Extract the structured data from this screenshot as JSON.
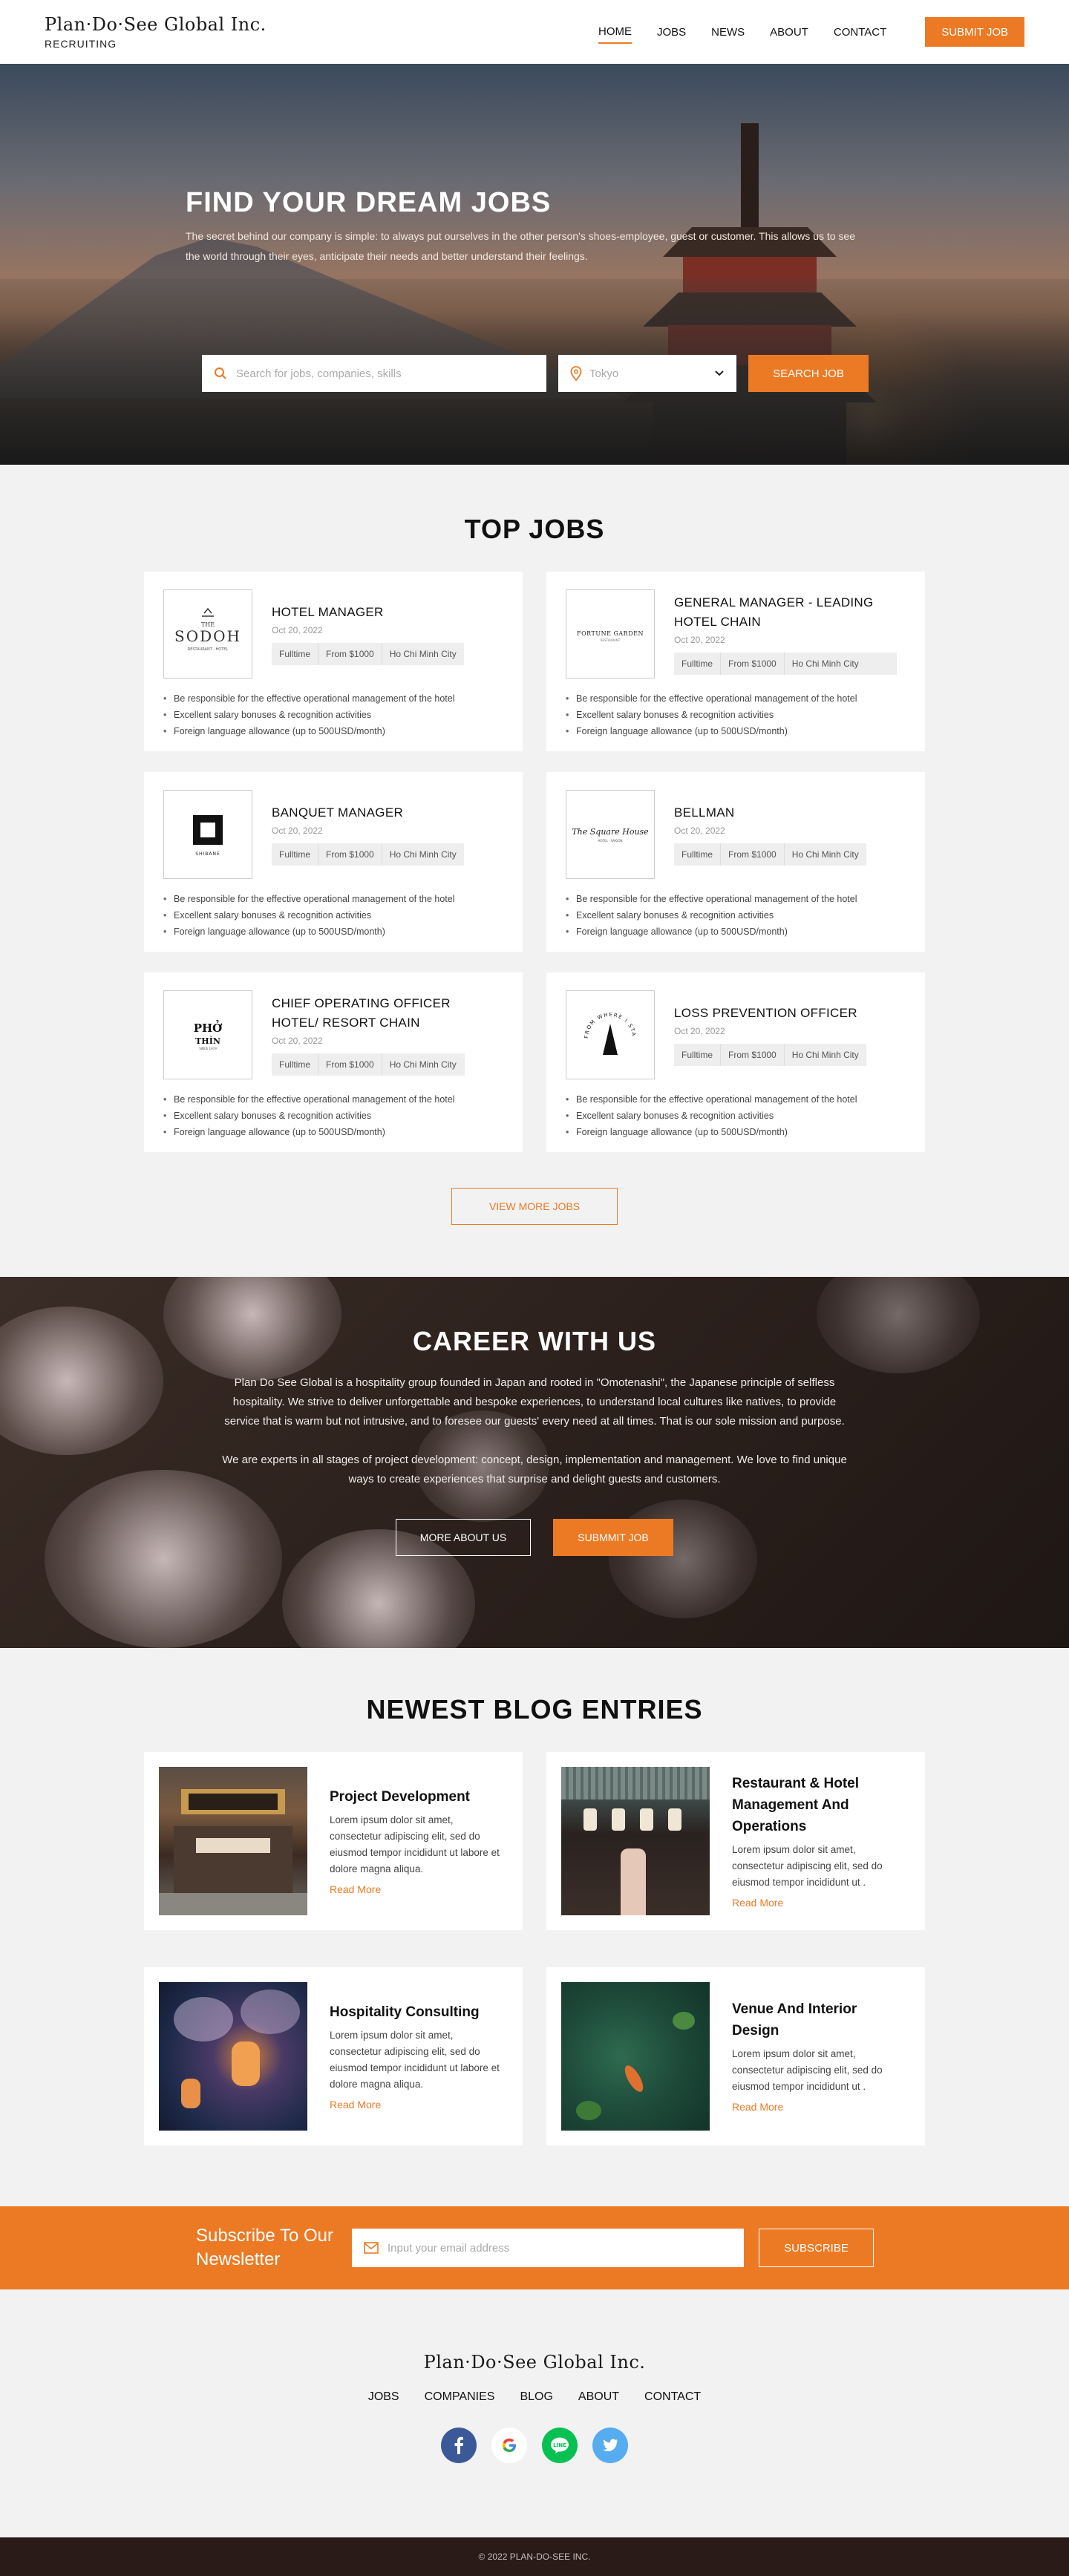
{
  "header": {
    "brand": "Plan·Do·See Global Inc.",
    "brand_sub": "RECRUITING",
    "nav": [
      "HOME",
      "JOBS",
      "NEWS",
      "ABOUT",
      "CONTACT"
    ],
    "active_nav": "HOME",
    "submit_label": "SUBMIT JOB"
  },
  "hero": {
    "title": "FIND YOUR DREAM JOBS",
    "description": "The secret behind our company is simple: to always put ourselves in the other person's shoes-employee, guest or customer. This allows us to see the world through their eyes,  anticipate their needs and better understand their feelings.",
    "search_placeholder": "Search for jobs, companies, skills",
    "location": "Tokyo",
    "search_label": "SEARCH JOB"
  },
  "top_jobs": {
    "title": "TOP JOBS",
    "jobs": [
      {
        "title": "HOTEL MANAGER",
        "date": "Oct 20, 2022",
        "logo": "THE SODOH"
      },
      {
        "title": "GENERAL MANAGER - LEADING HOTEL CHAIN",
        "date": "Oct 20, 2022",
        "logo": "FORTUNE GARDEN"
      },
      {
        "title": "BANQUET MANAGER",
        "date": "Oct 20, 2022",
        "logo": "SHIBANE"
      },
      {
        "title": "BELLMAN",
        "date": "Oct 20, 2022",
        "logo": "The Square House"
      },
      {
        "title": "CHIEF OPERATING OFFICER HOTEL/ RESORT CHAIN",
        "date": "Oct 20, 2022",
        "logo": "PHỞ THÌN"
      },
      {
        "title": "LOSS PREVENTION OFFICER",
        "date": "Oct 20, 2022",
        "logo": "FROM WHERE I STAND"
      }
    ],
    "tags": [
      "Fulltime",
      "From $1000",
      "Ho Chi Minh City"
    ],
    "bullets": [
      "Be responsible for the effective operational management of the hotel",
      "Excellent salary bonuses & recognition activities",
      "Foreign language allowance (up to 500USD/month)"
    ],
    "view_more": "VIEW MORE JOBS"
  },
  "career": {
    "title": "CAREER WITH US",
    "para1": "Plan Do See Global is a hospitality group founded in Japan and rooted in \"Omotenashi\", the Japanese principle of selfless hospitality. We strive to deliver unforgettable and bespoke experiences, to understand local cultures like natives, to provide service that is warm but not intrusive, and to foresee our guests' every need at all times. That is our sole mission and purpose.",
    "para2": "We are experts in all stages of project development: concept, design, implementation and management. We love to find unique ways to create experiences that surprise and delight guests and customers.",
    "more_label": "MORE ABOUT US",
    "submit_label": "SUBMMIT JOB"
  },
  "blog": {
    "title": "NEWEST BLOG ENTRIES",
    "entries": [
      {
        "title": "Project Development",
        "text": "Lorem ipsum dolor sit amet, consectetur adipiscing elit, sed do eiusmod tempor incididunt ut labore et dolore magna aliqua."
      },
      {
        "title": "Restaurant & Hotel Management And Operations",
        "text": "Lorem ipsum dolor sit amet, consectetur adipiscing elit, sed do eiusmod tempor incididunt ut ."
      },
      {
        "title": "Hospitality Consulting",
        "text": "Lorem ipsum dolor sit amet, consectetur adipiscing elit, sed do eiusmod tempor incididunt ut labore et dolore magna aliqua."
      },
      {
        "title": "Venue And Interior Design",
        "text": "Lorem ipsum dolor sit amet, consectetur adipiscing elit, sed do eiusmod tempor incididunt ut ."
      }
    ],
    "read_more": "Read More"
  },
  "newsletter": {
    "title": "Subscribe To Our Newsletter",
    "placeholder": "Input your email address",
    "button": "SUBSCRIBE"
  },
  "footer": {
    "brand": "Plan·Do·See Global Inc.",
    "nav": [
      "JOBS",
      "COMPANIES",
      "BLOG",
      "ABOUT",
      "CONTACT"
    ],
    "socials": [
      "facebook-icon",
      "google-icon",
      "line-icon",
      "twitter-icon"
    ],
    "copyright": "© 2022 PLAN-DO-SEE INC."
  },
  "colors": {
    "accent": "#ec7a24",
    "footer_bar": "#2a1a18",
    "facebook": "#3b5998",
    "line": "#06c152",
    "twitter": "#55acee"
  }
}
